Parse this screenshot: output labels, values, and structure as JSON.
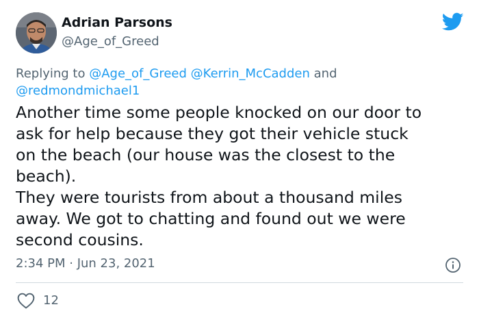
{
  "author": {
    "name": "Adrian Parsons",
    "handle": "@Age_of_Greed"
  },
  "reply": {
    "prefix": "Replying to",
    "mentions": [
      "@Age_of_Greed",
      "@Kerrin_McCadden",
      "@redmondmichael1"
    ],
    "joiner": "and"
  },
  "tweet": {
    "lines": [
      "Another time some people knocked on our door to",
      "ask for help because they got their vehicle stuck",
      "on the beach (our house was the closest to the",
      "beach).",
      "They were tourists from about a thousand miles",
      "away. We got to chatting and found out we were",
      "second cousins."
    ]
  },
  "meta": {
    "timestamp": "2:34 PM · Jun 23, 2021"
  },
  "actions": {
    "like_count": "12"
  },
  "icons": {
    "brand": "twitter-bird-icon",
    "info": "info-icon",
    "like": "heart-icon"
  },
  "colors": {
    "brand": "#1d9bf0",
    "text": "#0f1419",
    "muted": "#536471"
  }
}
